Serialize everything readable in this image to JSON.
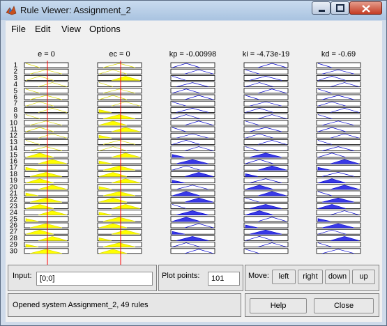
{
  "window": {
    "title": "Rule Viewer: Assignment_2"
  },
  "menu": [
    "File",
    "Edit",
    "View",
    "Options"
  ],
  "variables": [
    {
      "label": "e = 0",
      "kind": "input"
    },
    {
      "label": "ec = 0",
      "kind": "input"
    },
    {
      "label": "kp = -0.00998",
      "kind": "output"
    },
    {
      "label": "ki = -4.73e-19",
      "kind": "output"
    },
    {
      "label": "kd = -0.69",
      "kind": "output"
    }
  ],
  "rules_visible": [
    "1",
    "2",
    "3",
    "4",
    "5",
    "6",
    "7",
    "8",
    "9",
    "10",
    "11",
    "12",
    "13",
    "14",
    "15",
    "16",
    "17",
    "18",
    "19",
    "20",
    "21",
    "22",
    "23",
    "24",
    "25",
    "26",
    "27",
    "28",
    "29",
    "30"
  ],
  "colors": {
    "input_fill": "#ffff00",
    "input_line": "#d8d800",
    "output_fill": "#3a3ae6",
    "output_line": "#0000cc",
    "cursor": "#ff0000"
  },
  "input_panel": {
    "label": "Input:",
    "value": "[0;0]"
  },
  "plot_points": {
    "label": "Plot points:",
    "value": "101"
  },
  "move": {
    "label": "Move:",
    "buttons": [
      "left",
      "right",
      "down",
      "up"
    ]
  },
  "status": "Opened system Assignment_2, 49 rules",
  "actions": {
    "help": "Help",
    "close": "Close"
  }
}
